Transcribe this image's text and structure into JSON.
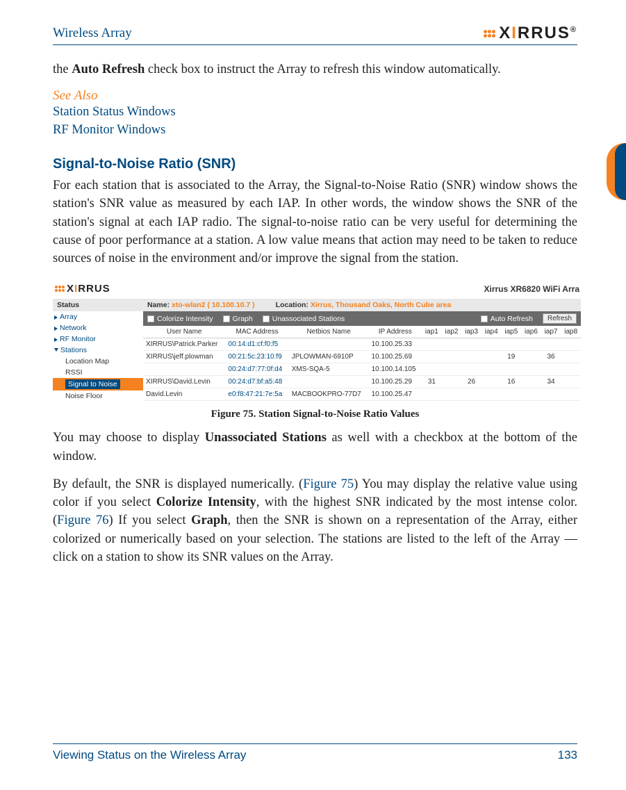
{
  "header": {
    "doc_title": "Wireless Array",
    "logo_text_pre": "X",
    "logo_text_i": "I",
    "logo_text_post": "RRUS"
  },
  "intro_para": {
    "pre": "the ",
    "bold": "Auto Refresh",
    "post": " check box to instruct the Array to refresh this window automatically."
  },
  "see_also": {
    "heading": "See Also",
    "links": [
      "Station Status Windows",
      "RF Monitor Windows"
    ]
  },
  "section": {
    "heading": "Signal-to-Noise Ratio (SNR)",
    "para": "For each station that is associated to the Array, the Signal-to-Noise Ratio (SNR) window shows the station's SNR value as measured by each IAP. In other words, the window shows the SNR of the station's signal at each IAP radio. The signal-to-noise ratio can be very useful for determining the cause of poor performance at a station. A low value means that action may need to be taken to reduce sources of noise in the environment and/or improve the signal from the station."
  },
  "screenshot": {
    "product_title": "Xirrus XR6820 WiFi Arra",
    "nav": {
      "status_label": "Status",
      "items": [
        "Array",
        "Network",
        "RF Monitor",
        "Stations"
      ],
      "subs": [
        "Location Map",
        "RSSI",
        "Signal to Noise",
        "Noise Floor"
      ],
      "selected_sub_index": 2
    },
    "infobar": {
      "name_label": "Name:",
      "name_value": "xto-wlan2   ( 10.100.10.7 )",
      "loc_label": "Location:",
      "loc_value": "Xirrus, Thousand Oaks, North Cube area"
    },
    "controls": {
      "colorize": "Colorize Intensity",
      "graph": "Graph",
      "unassoc": "Unassociated Stations",
      "auto": "Auto Refresh",
      "refresh": "Refresh"
    },
    "columns": [
      "User Name",
      "MAC Address",
      "Netbios Name",
      "IP Address",
      "iap1",
      "iap2",
      "iap3",
      "iap4",
      "iap5",
      "iap6",
      "iap7",
      "iap8"
    ],
    "rows": [
      {
        "user": "XIRRUS\\Patrick.Parker",
        "mac": "00:14:d1:cf:f0:f5",
        "nb": "",
        "ip": "10.100.25.33",
        "v": [
          "",
          "",
          "",
          "",
          "",
          "",
          "",
          ""
        ]
      },
      {
        "user": "XIRRUS\\jeff.plowman",
        "mac": "00:21:5c:23:10:f9",
        "nb": "JPLOWMAN-6910P",
        "ip": "10.100.25.69",
        "v": [
          "",
          "",
          "",
          "",
          "19",
          "",
          "36",
          ""
        ]
      },
      {
        "user": "",
        "mac": "00:24:d7:77:0f:d4",
        "nb": "XMS-SQA-5",
        "ip": "10.100.14.105",
        "v": [
          "",
          "",
          "",
          "",
          "",
          "",
          "",
          ""
        ]
      },
      {
        "user": "XIRRUS\\David.Levin",
        "mac": "00:24:d7:bf:a5:48",
        "nb": "",
        "ip": "10.100.25.29",
        "v": [
          "31",
          "",
          "26",
          "",
          "16",
          "",
          "34",
          ""
        ]
      },
      {
        "user": "David.Levin",
        "mac": "e0:f8:47:21:7e:5a",
        "nb": "MACBOOKPRO-77D7",
        "ip": "10.100.25.47",
        "v": [
          "",
          "",
          "",
          "",
          "",
          "",
          "",
          ""
        ]
      }
    ]
  },
  "figure_caption": "Figure 75. Station Signal-to-Noise Ratio Values",
  "para2": {
    "pre": "You may choose to display ",
    "bold": "Unassociated Stations",
    "post": " as well with a checkbox at the bottom of the window."
  },
  "para3": {
    "t1": "By default, the SNR is displayed numerically. (",
    "f1": "Figure 75",
    "t2": ") You may display the relative value using color if you select ",
    "b1": "Colorize Intensity",
    "t3": ", with the highest SNR indicated by the most intense color. (",
    "f2": "Figure 76",
    "t4": ") If you select ",
    "b2": "Graph",
    "t5": ", then the SNR is shown on a representation of the Array, either colorized or numerically based on your selection. The stations are listed to the left of the Array — click on a station to show its SNR values on the Array."
  },
  "footer": {
    "left": "Viewing Status on the Wireless Array",
    "right": "133"
  }
}
